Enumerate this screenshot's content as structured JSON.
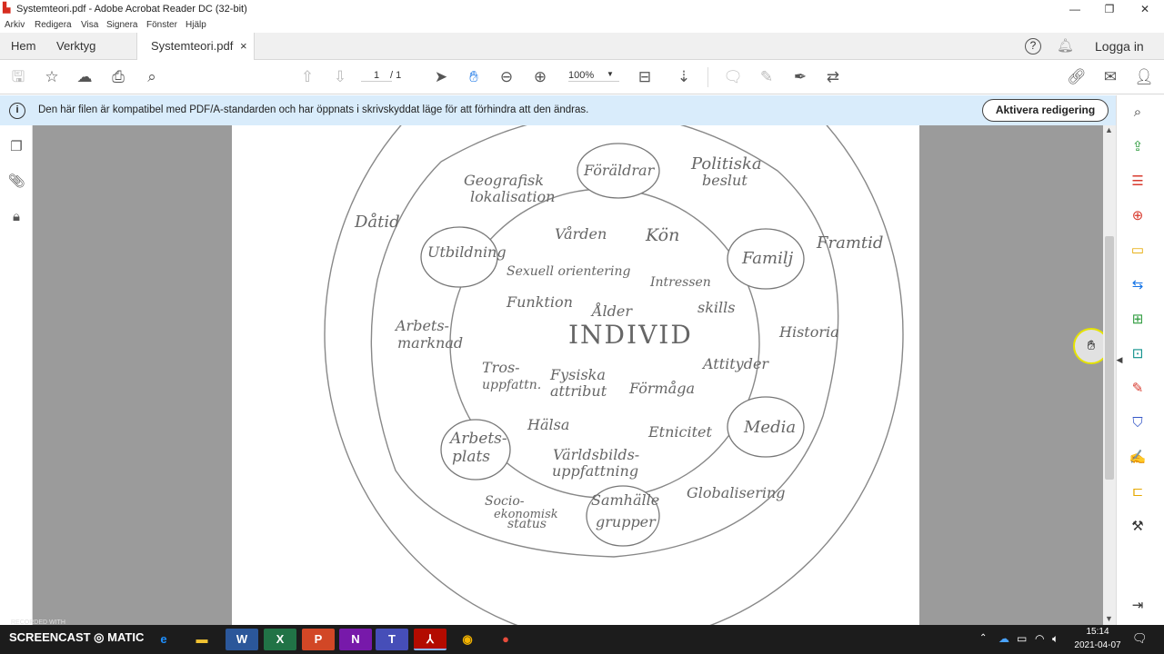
{
  "window": {
    "title": "Systemteori.pdf - Adobe Acrobat Reader DC (32-bit)",
    "minimize": "—",
    "maximize": "❐",
    "close": "✕"
  },
  "menu": [
    "Arkiv",
    "Redigera",
    "Visa",
    "Signera",
    "Fönster",
    "Hjälp"
  ],
  "tabs": {
    "home": "Hem",
    "tools": "Verktyg",
    "document": "Systemteori.pdf",
    "close": "×",
    "login": "Logga in"
  },
  "toolbar": {
    "page_current": "1",
    "page_total": "/ 1",
    "zoom": "100%"
  },
  "infobar": {
    "message": "Den här filen är kompatibel med PDF/A-standarden och har öppnats i skrivskyddat läge för att förhindra att den ändras.",
    "enable_button": "Aktivera redigering"
  },
  "diagram": {
    "center": "INDIVID",
    "inner": [
      "Vården",
      "Kön",
      "Sexuell orientering",
      "Intressen",
      "Funktion",
      "Ålder",
      "skills",
      "Tros-",
      "uppfattn.",
      "Fysiska",
      "attribut",
      "Förmåga",
      "Attityder",
      "Hälsa",
      "Etnicitet",
      "Världsbilds-",
      "uppfattning"
    ],
    "bubbles": [
      "Föräldrar",
      "Utbildning",
      "Familj",
      "Arbets-",
      "plats",
      "Media",
      "Samhälle",
      "grupper"
    ],
    "middle": [
      "Geografisk",
      "lokalisation",
      "Politiska",
      "beslut",
      "Arbets-",
      "marknad",
      "Historia",
      "Socio-",
      "ekonomisk",
      "status",
      "Globalisering"
    ],
    "outer": [
      "Dåtid",
      "Framtid"
    ]
  },
  "taskbar": {
    "watermark_small": "RECORDED WITH",
    "watermark": "SCREENCAST ◎ MATIC",
    "time": "15:14",
    "date": "2021-04-07"
  }
}
